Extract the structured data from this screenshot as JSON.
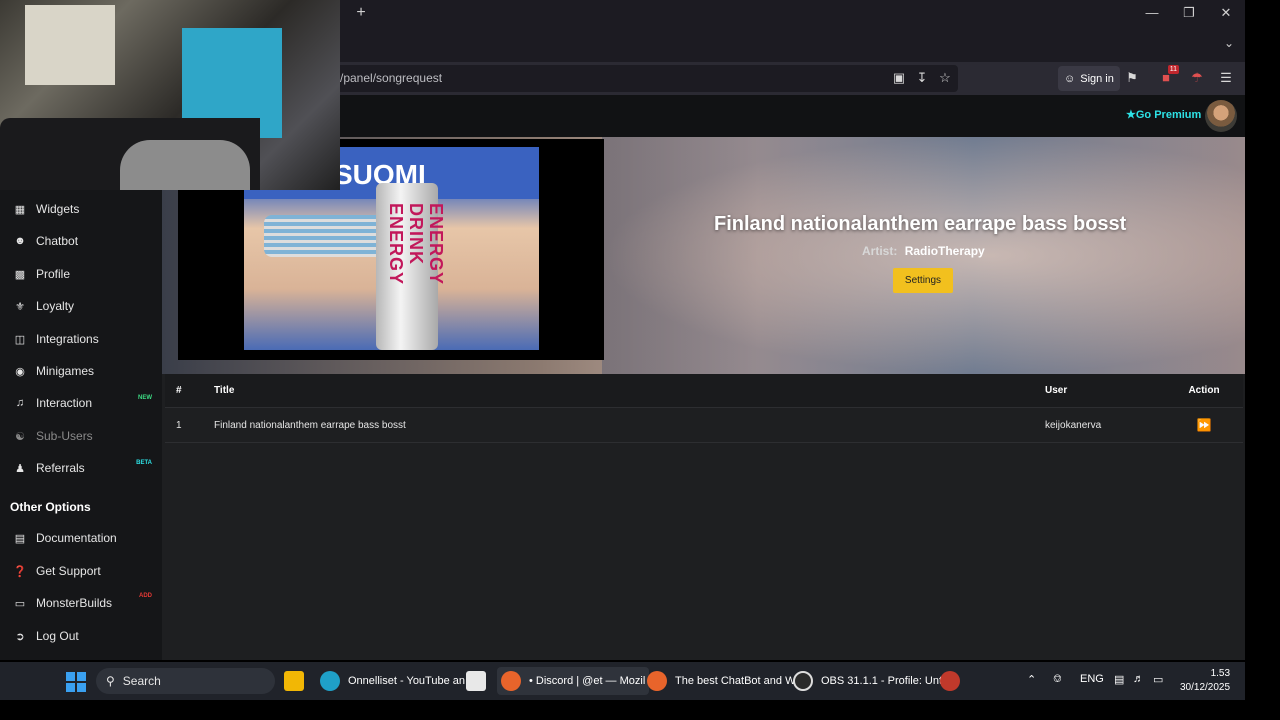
{
  "browser": {
    "new_tab_icon": "plus-icon",
    "url": "/panel/songrequest",
    "sign_in_label": "Sign in",
    "extension_badge": "11",
    "window_controls": [
      "minimize-icon",
      "restore-icon",
      "close-icon"
    ]
  },
  "header": {
    "go_premium_label": "Go Premium"
  },
  "sidebar": {
    "items": [
      {
        "label": "Widgets",
        "icon": "widgets-icon",
        "badge": ""
      },
      {
        "label": "Chatbot",
        "icon": "robot-icon",
        "badge": ""
      },
      {
        "label": "Profile",
        "icon": "id-card-icon",
        "badge": ""
      },
      {
        "label": "Loyalty",
        "icon": "trophy-icon",
        "badge": ""
      },
      {
        "label": "Integrations",
        "icon": "plug-icon",
        "badge": ""
      },
      {
        "label": "Minigames",
        "icon": "gamepad-icon",
        "badge": ""
      },
      {
        "label": "Interaction",
        "icon": "music-icon",
        "badge": "NEW"
      },
      {
        "label": "Sub-Users",
        "icon": "users-icon",
        "badge": ""
      },
      {
        "label": "Referrals",
        "icon": "user-group-icon",
        "badge": "BETA"
      }
    ],
    "other_options_heading": "Other Options",
    "other_items": [
      {
        "label": "Documentation",
        "icon": "book-icon",
        "badge": ""
      },
      {
        "label": "Get Support",
        "icon": "question-icon",
        "badge": ""
      },
      {
        "label": "MonsterBuilds",
        "icon": "laptop-icon",
        "badge": "ADD"
      },
      {
        "label": "Log Out",
        "icon": "logout-icon",
        "badge": ""
      }
    ]
  },
  "player": {
    "now_playing_title": "Finland nationalanthem earrape bass bosst",
    "artist_label": "Artist:",
    "artist_name": "RadioTherapy",
    "settings_label": "Settings",
    "video_hat_text": "SUOMI",
    "video_can_text": "ENERGY DRINK ENERGY"
  },
  "queue": {
    "headers": {
      "num": "#",
      "title": "Title",
      "user": "User",
      "action": "Action"
    },
    "rows": [
      {
        "num": "1",
        "title": "Finland nationalanthem earrape bass bosst",
        "user": "keijokanerva"
      }
    ]
  },
  "taskbar": {
    "search_placeholder": "Search",
    "apps": [
      {
        "label": "Onnelliset - YouTube an",
        "icon": "edge-icon"
      },
      {
        "label": "• Discord | @et — Mozil",
        "icon": "firefox-icon"
      },
      {
        "label": "The best ChatBot and W",
        "icon": "firefox-icon"
      },
      {
        "label": "OBS 31.1.1 - Profile: Unti",
        "icon": "obs-icon"
      }
    ],
    "language": "ENG",
    "time": "1.53",
    "date": "30/12/2025"
  },
  "colors": {
    "accent_premium": "#2de2e6",
    "settings_button": "#f2c01e",
    "badge_new": "#3ddc84",
    "badge_beta": "#2de2e6",
    "badge_add": "#e53935"
  }
}
